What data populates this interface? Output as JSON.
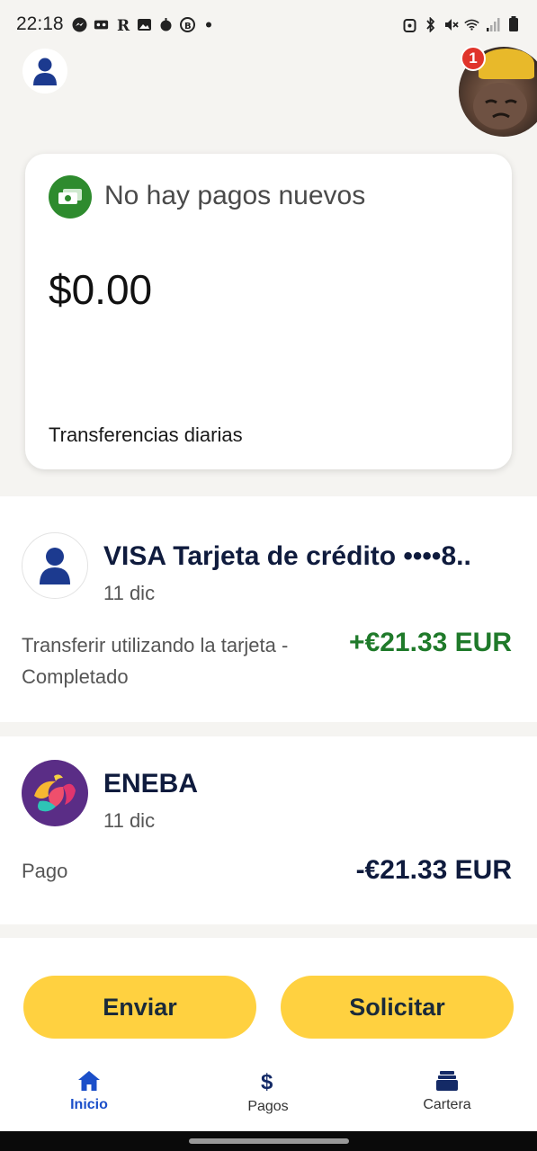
{
  "status_bar": {
    "time": "22:18",
    "left_icons": [
      "messenger-icon",
      "voicemail-icon",
      "r-app-icon",
      "gallery-icon",
      "bug-icon",
      "b-app-icon",
      "dot-icon"
    ],
    "right_icons": [
      "alarm-icon",
      "bluetooth-icon",
      "mute-icon",
      "wifi-icon",
      "signal-icon",
      "battery-icon"
    ]
  },
  "header": {
    "notification_count": "1"
  },
  "payments_card": {
    "title": "No hay pagos nuevos",
    "amount": "$0.00",
    "subtitle": "Transferencias diarias",
    "icon_color": "#2e8b2e"
  },
  "transactions": [
    {
      "name": "VISA Tarjeta de crédito ••••8..",
      "date": "11 dic",
      "description": "Transferir utilizando la tarjeta - Completado",
      "amount": "+€21.33 EUR",
      "amount_color": "#1f7a2a"
    },
    {
      "name": "ENEBA",
      "date": "11 dic",
      "description": "Pago",
      "amount": "-€21.33 EUR",
      "amount_color": "#0f1b3d"
    }
  ],
  "actions": {
    "send_label": "Enviar",
    "request_label": "Solicitar",
    "button_color": "#ffd140"
  },
  "bottom_nav": {
    "items": [
      {
        "label": "Inicio",
        "icon": "home-icon",
        "active": true
      },
      {
        "label": "Pagos",
        "icon": "dollar-icon",
        "active": false
      },
      {
        "label": "Cartera",
        "icon": "wallet-icon",
        "active": false
      }
    ],
    "active_color": "#1b4fc9"
  }
}
